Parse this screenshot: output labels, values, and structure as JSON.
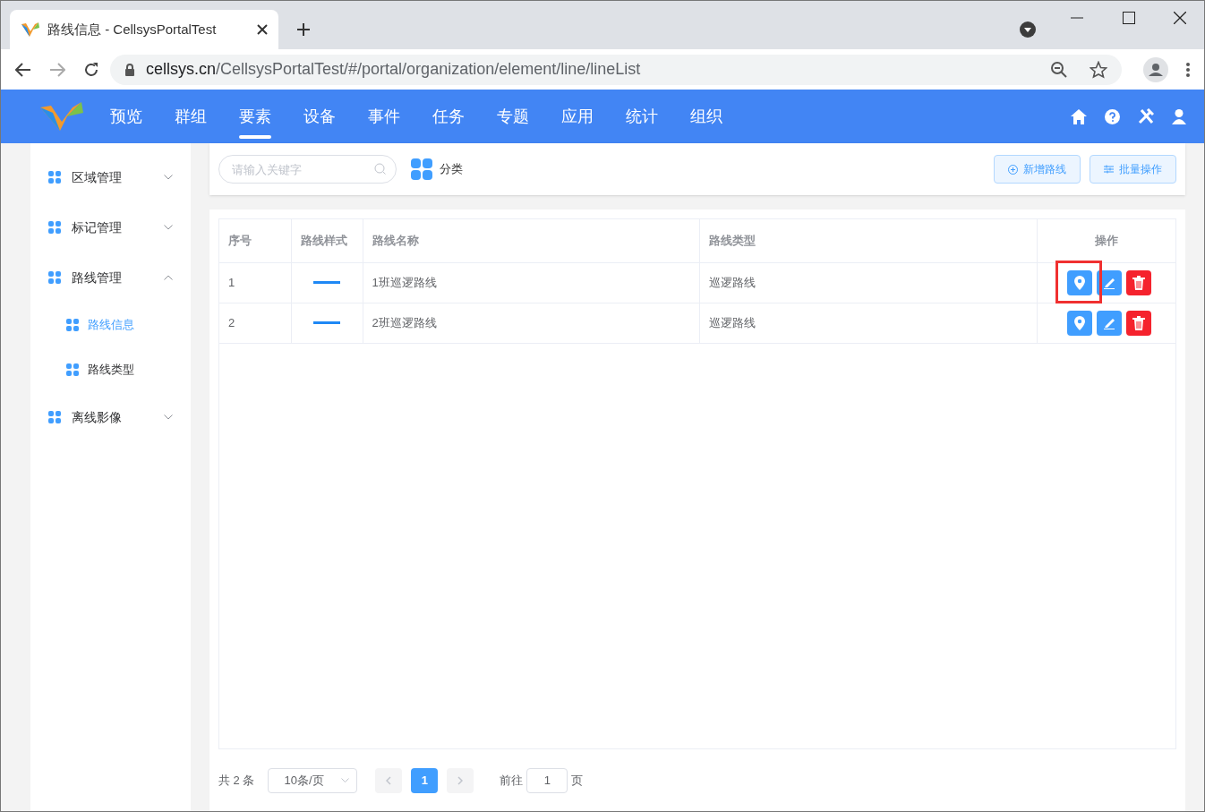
{
  "browser": {
    "tab_title": "路线信息 - CellsysPortalTest",
    "url_host": "cellsys.cn",
    "url_path": "/CellsysPortalTest/#/portal/organization/element/line/lineList"
  },
  "nav": {
    "items": [
      {
        "label": "预览",
        "selected": false
      },
      {
        "label": "群组",
        "selected": false
      },
      {
        "label": "要素",
        "selected": true
      },
      {
        "label": "设备",
        "selected": false
      },
      {
        "label": "事件",
        "selected": false
      },
      {
        "label": "任务",
        "selected": false
      },
      {
        "label": "专题",
        "selected": false
      },
      {
        "label": "应用",
        "selected": false
      },
      {
        "label": "统计",
        "selected": false
      },
      {
        "label": "组织",
        "selected": false
      }
    ]
  },
  "sidebar": {
    "items": [
      {
        "label": "区域管理",
        "expanded": false
      },
      {
        "label": "标记管理",
        "expanded": false
      },
      {
        "label": "路线管理",
        "expanded": true,
        "children": [
          {
            "label": "路线信息",
            "selected": true
          },
          {
            "label": "路线类型",
            "selected": false
          }
        ]
      },
      {
        "label": "离线影像",
        "expanded": false
      }
    ]
  },
  "toolbar": {
    "search": {
      "placeholder": "请输入关键字"
    },
    "category": "分类",
    "buttons": [
      "新增路线",
      "批量操作"
    ]
  },
  "table": {
    "columns": [
      "序号",
      "路线样式",
      "路线名称",
      "路线类型",
      "操作"
    ],
    "rows": [
      {
        "index": "1",
        "color": "#1e88f5",
        "name": "1班巡逻路线",
        "type": "巡逻路线",
        "highlighted": true
      },
      {
        "index": "2",
        "color": "#1e88f5",
        "name": "2班巡逻路线",
        "type": "巡逻路线",
        "highlighted": false
      }
    ]
  },
  "pagination": {
    "total": "共 2 条",
    "page_size": "10条/页",
    "pages": [
      {
        "label": "1",
        "selected": true
      }
    ],
    "goto_label": "前往",
    "goto_value": "1",
    "page_suffix": "页"
  }
}
